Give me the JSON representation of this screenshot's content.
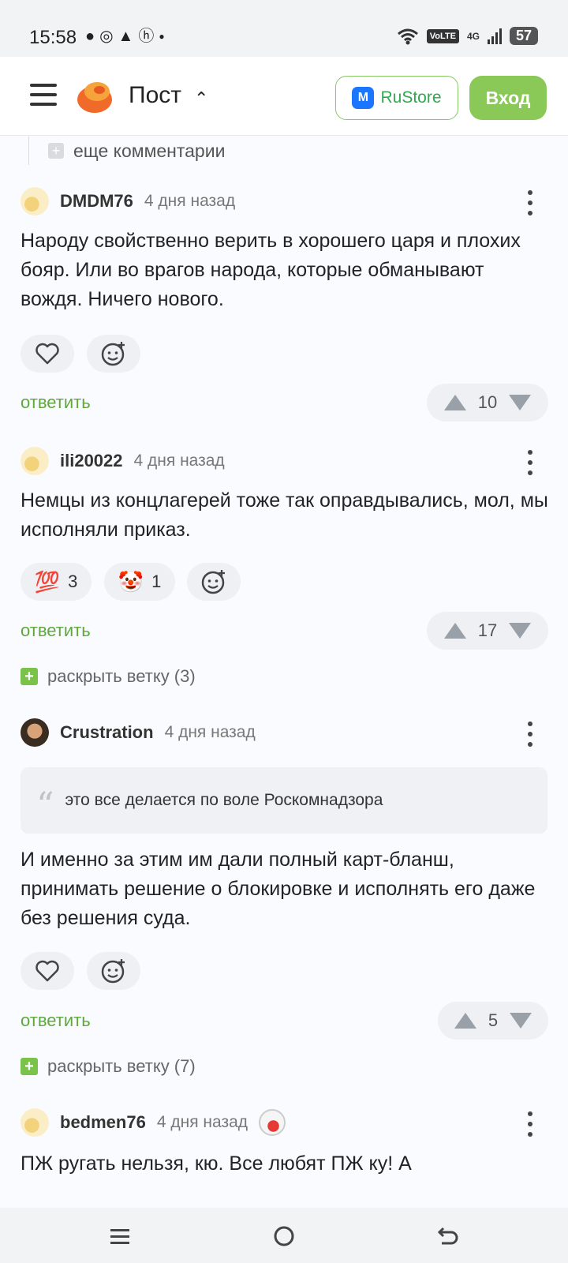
{
  "status_bar": {
    "time": "15:58",
    "notification_icons": [
      "chat-bubble-icon",
      "whatsapp-icon",
      "warning-icon",
      "hh-icon",
      "dot-icon"
    ],
    "volte": "VoLTE",
    "network": "4G",
    "battery": "57"
  },
  "header": {
    "title": "Пост",
    "rustore_label": "RuStore",
    "rustore_badge": "M",
    "login_label": "Вход"
  },
  "thread": {
    "more_comments_label": "еще комментарии"
  },
  "comments": [
    {
      "username": "DMDM76",
      "time": "4 дня назад",
      "text": "Народу свойственно верить в хорошего царя и плохих бояр. Или во врагов народа, которые обманывают вождя. Ничего нового.",
      "reply_label": "ответить",
      "votes": "10"
    },
    {
      "username": "ili20022",
      "time": "4 дня назад",
      "text": "Немцы из концлагерей тоже так оправдывались, мол, мы исполняли приказ.",
      "reactions": [
        {
          "emoji": "💯",
          "count": "3"
        },
        {
          "emoji": "🤡",
          "count": "1"
        }
      ],
      "reply_label": "ответить",
      "votes": "17",
      "expand_label": "раскрыть ветку (3)"
    },
    {
      "username": "Crustration",
      "time": "4 дня назад",
      "quote": "это все делается по воле Роскомнадзора",
      "text": "И именно за этим им дали полный карт-бланш, принимать решение о блокировке и исполнять его даже без решения суда.",
      "reply_label": "ответить",
      "votes": "5",
      "expand_label": "раскрыть ветку (7)"
    },
    {
      "username": "bedmen76",
      "time": "4 дня назад",
      "text": "ПЖ ругать нельзя, кю. Все любят ПЖ ку! А"
    }
  ],
  "colors": {
    "accent_green": "#8ac858",
    "link_green": "#5ea83d",
    "rustore_blue": "#1b76ff",
    "logo_orange": "#f06a2a"
  }
}
